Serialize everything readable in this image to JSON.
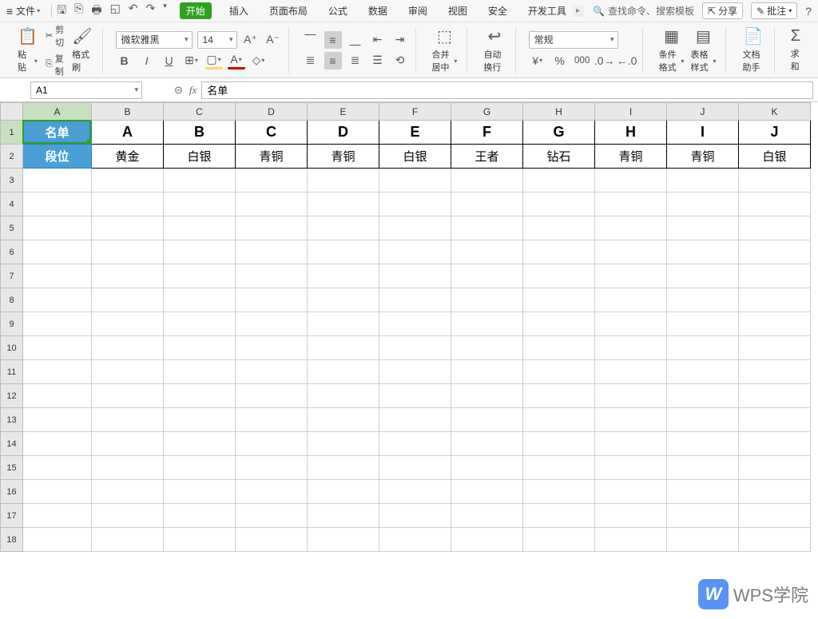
{
  "menubar": {
    "file_label": "文件",
    "tabs": [
      "开始",
      "插入",
      "页面布局",
      "公式",
      "数据",
      "审阅",
      "视图",
      "安全",
      "开发工具"
    ],
    "active_tab_index": 0,
    "search_placeholder": "查找命令、搜索模板",
    "share_label": "分享",
    "comment_label": "批注"
  },
  "ribbon": {
    "paste_label": "粘贴",
    "cut_label": "剪切",
    "copy_label": "复制",
    "format_painter_label": "格式刷",
    "font_name": "微软雅黑",
    "font_size": "14",
    "merge_label": "合并居中",
    "wrap_label": "自动换行",
    "number_format": "常规",
    "cond_format_label": "条件格式",
    "table_style_label": "表格样式",
    "doc_helper_label": "文档助手",
    "sum_label": "求和"
  },
  "formula_bar": {
    "cell_ref": "A1",
    "formula_value": "名单"
  },
  "sheet": {
    "columns": [
      "A",
      "B",
      "C",
      "D",
      "E",
      "F",
      "G",
      "H",
      "I",
      "J",
      "K"
    ],
    "rows": [
      "1",
      "2",
      "3",
      "4",
      "5",
      "6",
      "7",
      "8",
      "9",
      "10",
      "11",
      "12",
      "13",
      "14",
      "15",
      "16",
      "17",
      "18"
    ],
    "row1_label": "名单",
    "row2_label": "段位",
    "row1_data": [
      "A",
      "B",
      "C",
      "D",
      "E",
      "F",
      "G",
      "H",
      "I",
      "J"
    ],
    "row2_data": [
      "黄金",
      "白银",
      "青铜",
      "青铜",
      "白银",
      "王者",
      "钻石",
      "青铜",
      "青铜",
      "白银"
    ]
  },
  "watermark": {
    "logo": "W",
    "text": "WPS学院"
  }
}
